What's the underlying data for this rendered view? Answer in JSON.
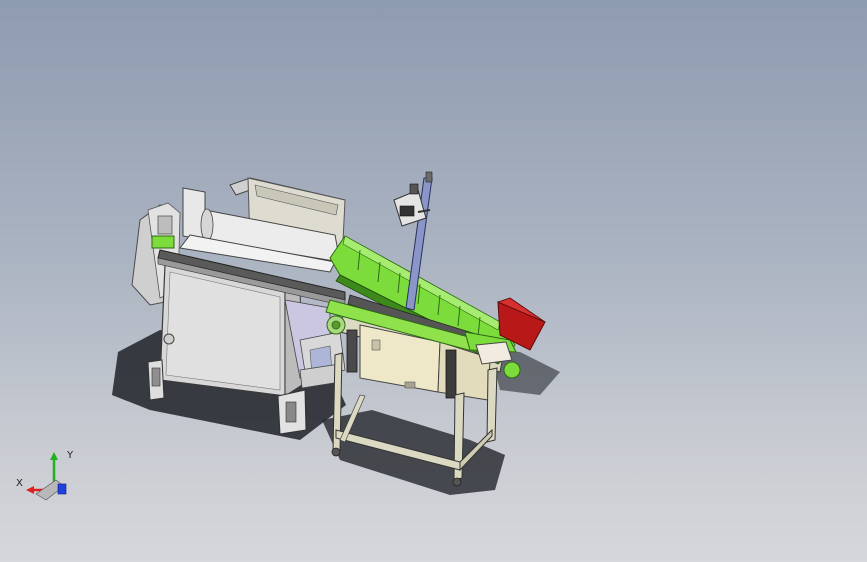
{
  "viewport": {
    "background_top": "#8e9bb0",
    "background_bottom": "#d6d7da"
  },
  "triad": {
    "x_label": "X",
    "y_label": "Y",
    "x_color": "#e02020",
    "y_color": "#20b020",
    "z_color": "#2040e0"
  },
  "colors": {
    "frame": "#dcd9c2",
    "panel": "#d2d2d2",
    "green": "#7cdc3c",
    "green_dark": "#3d8a1a",
    "bin_red": "#b81818",
    "post_blue": "#8a96c8",
    "cabinet_face": "#efe8c8"
  }
}
